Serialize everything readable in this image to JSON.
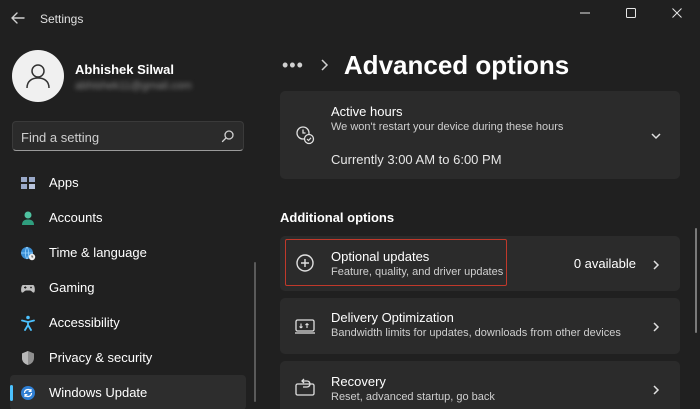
{
  "window": {
    "title": "Settings",
    "controls": [
      "minimize",
      "maximize",
      "close"
    ]
  },
  "user": {
    "name": "Abhishek Silwal",
    "email": "abhishek11@gmail.com"
  },
  "search": {
    "placeholder": "Find a setting",
    "icon": "search-icon"
  },
  "nav": {
    "items": [
      {
        "label": "Apps",
        "icon": "apps-icon",
        "color": "#9aa9c9"
      },
      {
        "label": "Accounts",
        "icon": "accounts-icon",
        "color": "#4fc3a1"
      },
      {
        "label": "Time & language",
        "icon": "globe-clock-icon",
        "color": "#4cc2ff"
      },
      {
        "label": "Gaming",
        "icon": "gamepad-icon",
        "color": "#bfbfbf"
      },
      {
        "label": "Accessibility",
        "icon": "accessibility-icon",
        "color": "#4cc2ff"
      },
      {
        "label": "Privacy & security",
        "icon": "shield-icon",
        "color": "#a0a0a0"
      },
      {
        "label": "Windows Update",
        "icon": "update-icon",
        "color": "#4cc2ff",
        "active": true
      }
    ]
  },
  "breadcrumb": {
    "more": "•••",
    "title": "Advanced options"
  },
  "active_hours": {
    "title": "Active hours",
    "subtitle": "We won't restart your device during these hours",
    "current": "Currently 3:00 AM to 6:00 PM"
  },
  "additional": {
    "section_title": "Additional options",
    "items": [
      {
        "title": "Optional updates",
        "subtitle": "Feature, quality, and driver updates",
        "value": "0 available",
        "icon": "plus-circle-icon"
      },
      {
        "title": "Delivery Optimization",
        "subtitle": "Bandwidth limits for updates, downloads from other devices",
        "icon": "delivery-icon"
      },
      {
        "title": "Recovery",
        "subtitle": "Reset, advanced startup, go back",
        "icon": "recovery-icon"
      }
    ]
  },
  "colors": {
    "accent": "#4cc2ff",
    "highlight": "#c0392b",
    "background": "#202020",
    "card": "#2b2b2b"
  }
}
